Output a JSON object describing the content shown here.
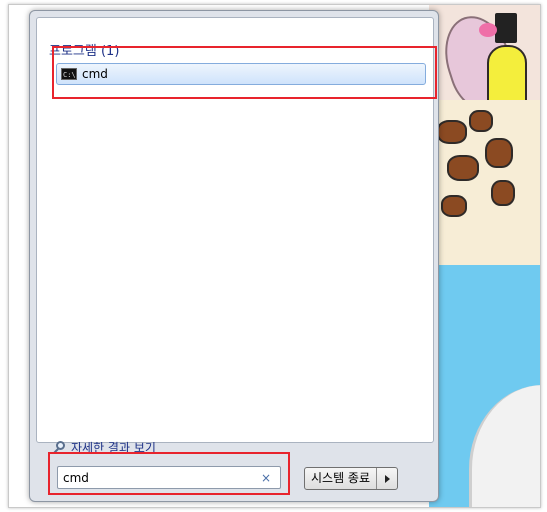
{
  "start_menu": {
    "category_label": "프로그램 (1)",
    "results": [
      {
        "label": "cmd",
        "icon": "cmd-icon"
      }
    ],
    "more_results_label": "자세한 결과 보기",
    "search": {
      "value": "cmd",
      "clear_glyph": "×"
    },
    "shutdown": {
      "label": "시스템 종료"
    }
  },
  "colors": {
    "highlight": "#e8242d",
    "category_text": "#1e3287",
    "selected_item": "#cfe3fb"
  }
}
